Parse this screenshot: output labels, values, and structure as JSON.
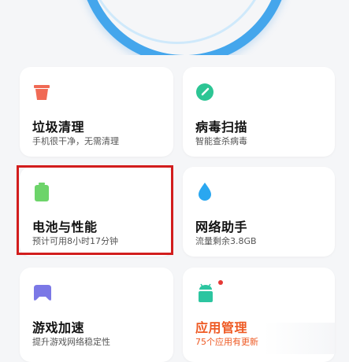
{
  "cards": [
    {
      "title": "垃圾清理",
      "subtitle": "手机很干净，无需清理",
      "icon": "trash-icon",
      "color": "#f06a55"
    },
    {
      "title": "病毒扫描",
      "subtitle": "智能查杀病毒",
      "icon": "scan-icon",
      "color": "#2cc594"
    },
    {
      "title": "电池与性能",
      "subtitle": "预计可用8小时17分钟",
      "icon": "battery-icon",
      "color": "#6dd46a"
    },
    {
      "title": "网络助手",
      "subtitle": "流量剩余3.8GB",
      "icon": "water-drop-icon",
      "color": "#2aa7f0"
    },
    {
      "title": "游戏加速",
      "subtitle": "提升游戏网络稳定性",
      "icon": "gamepad-icon",
      "color": "#7b78e6"
    },
    {
      "title": "应用管理",
      "subtitle": "75个应用有更新",
      "icon": "android-icon",
      "color": "#2cc5a0",
      "accent": "#ee5a24"
    }
  ],
  "accent_highlight": "#d21d1d",
  "ring_color": "#44a6ec"
}
